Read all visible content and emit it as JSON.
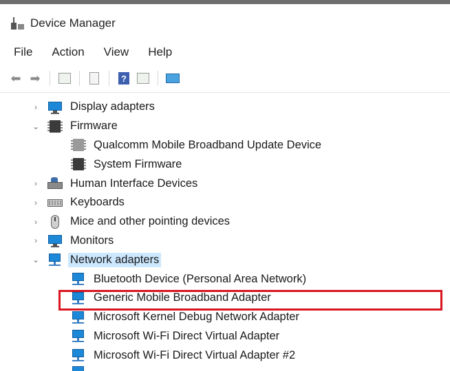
{
  "window": {
    "title": "Device Manager"
  },
  "menu": {
    "items": [
      "File",
      "Action",
      "View",
      "Help"
    ]
  },
  "toolbar": {
    "buttons": [
      {
        "icon": "back-arrow-icon"
      },
      {
        "icon": "forward-arrow-icon"
      },
      {
        "icon": "properties-icon"
      },
      {
        "icon": "document-icon"
      },
      {
        "icon": "help-icon",
        "glyph": "?"
      },
      {
        "icon": "update-driver-icon"
      },
      {
        "icon": "scan-hardware-icon"
      }
    ]
  },
  "tree": {
    "nodes": [
      {
        "label": "Display adapters",
        "level": 0,
        "chevron": "›",
        "icon": "monitor-icon"
      },
      {
        "label": "Firmware",
        "level": 0,
        "chevron": "⌄",
        "icon": "chip-icon"
      },
      {
        "label": "Qualcomm Mobile Broadband Update Device",
        "level": 1,
        "icon": "chip-icon"
      },
      {
        "label": "System Firmware",
        "level": 1,
        "icon": "chip-icon"
      },
      {
        "label": "Human Interface Devices",
        "level": 0,
        "chevron": "›",
        "icon": "hid-icon"
      },
      {
        "label": "Keyboards",
        "level": 0,
        "chevron": "›",
        "icon": "keyboard-icon"
      },
      {
        "label": "Mice and other pointing devices",
        "level": 0,
        "chevron": "›",
        "icon": "mouse-icon"
      },
      {
        "label": "Monitors",
        "level": 0,
        "chevron": "›",
        "icon": "monitor-icon"
      },
      {
        "label": "Network adapters",
        "level": 0,
        "chevron": "⌄",
        "icon": "network-adapter-icon",
        "selected": true
      },
      {
        "label": "Bluetooth Device (Personal Area Network)",
        "level": 1,
        "icon": "network-adapter-icon"
      },
      {
        "label": "Generic Mobile Broadband Adapter",
        "level": 1,
        "icon": "network-adapter-icon",
        "highlighted": true
      },
      {
        "label": "Microsoft Kernel Debug Network Adapter",
        "level": 1,
        "icon": "network-adapter-icon"
      },
      {
        "label": "Microsoft Wi-Fi Direct Virtual Adapter",
        "level": 1,
        "icon": "network-adapter-icon"
      },
      {
        "label": "Microsoft Wi-Fi Direct Virtual Adapter #2",
        "level": 1,
        "icon": "network-adapter-icon"
      }
    ]
  },
  "colors": {
    "highlight_border": "#d9141e",
    "selection": "#cce8ff",
    "accent_blue": "#1e88d8"
  }
}
